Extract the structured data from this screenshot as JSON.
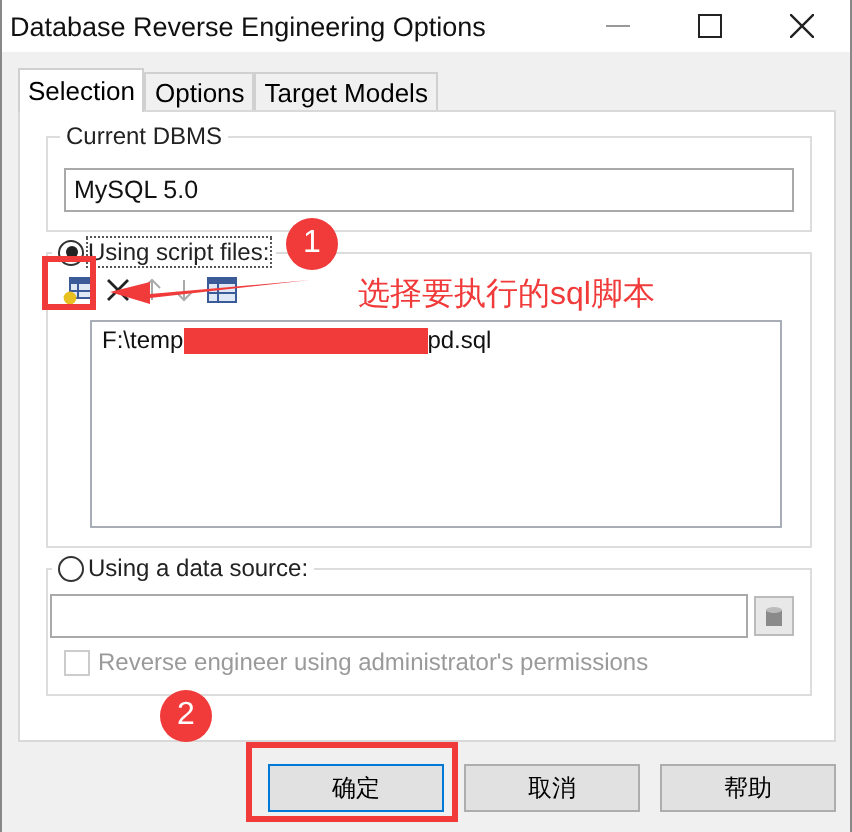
{
  "window": {
    "title": "Database Reverse Engineering Options"
  },
  "tabs": [
    {
      "label": "Selection",
      "selected": true
    },
    {
      "label": "Options",
      "selected": false
    },
    {
      "label": "Target Models",
      "selected": false
    }
  ],
  "current_dbms": {
    "label": "Current DBMS",
    "value": "MySQL 5.0"
  },
  "script_files": {
    "label": "Using script files:",
    "selected": true,
    "files": [
      {
        "start": "F:\\temp",
        "end": "pd.sql"
      }
    ]
  },
  "data_source": {
    "label": "Using a data source:",
    "selected": false,
    "checkbox": {
      "label": "Reverse engineer using administrator's permissions",
      "checked": false,
      "disabled": true
    }
  },
  "buttons": [
    {
      "label": "确定",
      "default": true
    },
    {
      "label": "取消",
      "default": false
    },
    {
      "label": "帮助",
      "default": false
    }
  ],
  "annotations": [
    {
      "kind": "badge",
      "label": "1"
    },
    {
      "kind": "note",
      "label": "选择要执行的sql脚本"
    },
    {
      "kind": "badge",
      "label": "2"
    }
  ]
}
